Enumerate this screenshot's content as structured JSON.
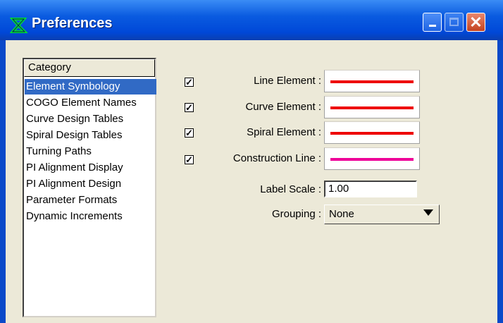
{
  "window": {
    "title": "Preferences",
    "app_icon": "bentley-b-icon",
    "controls": [
      "minimize-icon",
      "maximize-icon",
      "close-icon"
    ],
    "title_color": "#0a5be0"
  },
  "category_list": {
    "header": "Category",
    "items": [
      {
        "label": "Element Symbology",
        "selected": true
      },
      {
        "label": "COGO Element Names",
        "selected": false
      },
      {
        "label": "Curve Design Tables",
        "selected": false
      },
      {
        "label": "Spiral Design Tables",
        "selected": false
      },
      {
        "label": "Turning Paths",
        "selected": false
      },
      {
        "label": "PI Alignment Display",
        "selected": false
      },
      {
        "label": "PI Alignment Design",
        "selected": false
      },
      {
        "label": "Parameter Formats",
        "selected": false
      },
      {
        "label": "Dynamic Increments",
        "selected": false
      }
    ]
  },
  "symbology": {
    "rows": [
      {
        "label": "Line Element :",
        "checked": true,
        "color": "#ee0000"
      },
      {
        "label": "Curve Element :",
        "checked": true,
        "color": "#ee0000"
      },
      {
        "label": "Spiral Element :",
        "checked": true,
        "color": "#ee0000"
      },
      {
        "label": "Construction Line :",
        "checked": true,
        "color": "#ee0099"
      }
    ],
    "check_glyph": "✓"
  },
  "label_scale": {
    "label": "Label Scale :",
    "value": "1.00"
  },
  "grouping": {
    "label": "Grouping :",
    "value": "None"
  }
}
